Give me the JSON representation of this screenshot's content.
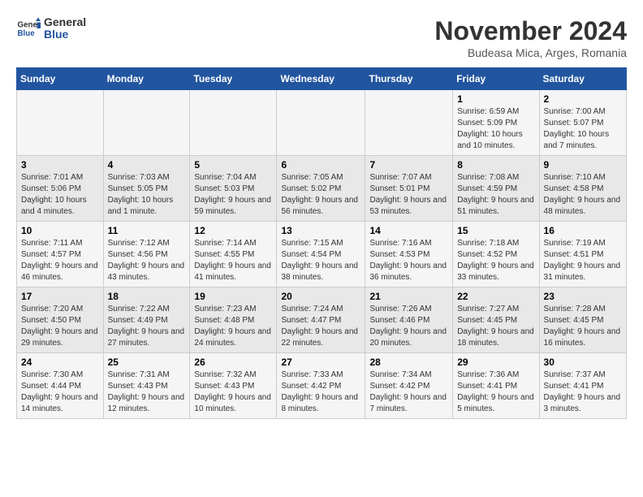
{
  "logo": {
    "line1": "General",
    "line2": "Blue"
  },
  "title": "November 2024",
  "subtitle": "Budeasa Mica, Arges, Romania",
  "weekdays": [
    "Sunday",
    "Monday",
    "Tuesday",
    "Wednesday",
    "Thursday",
    "Friday",
    "Saturday"
  ],
  "weeks": [
    [
      {
        "day": "",
        "info": ""
      },
      {
        "day": "",
        "info": ""
      },
      {
        "day": "",
        "info": ""
      },
      {
        "day": "",
        "info": ""
      },
      {
        "day": "",
        "info": ""
      },
      {
        "day": "1",
        "info": "Sunrise: 6:59 AM\nSunset: 5:09 PM\nDaylight: 10 hours and 10 minutes."
      },
      {
        "day": "2",
        "info": "Sunrise: 7:00 AM\nSunset: 5:07 PM\nDaylight: 10 hours and 7 minutes."
      }
    ],
    [
      {
        "day": "3",
        "info": "Sunrise: 7:01 AM\nSunset: 5:06 PM\nDaylight: 10 hours and 4 minutes."
      },
      {
        "day": "4",
        "info": "Sunrise: 7:03 AM\nSunset: 5:05 PM\nDaylight: 10 hours and 1 minute."
      },
      {
        "day": "5",
        "info": "Sunrise: 7:04 AM\nSunset: 5:03 PM\nDaylight: 9 hours and 59 minutes."
      },
      {
        "day": "6",
        "info": "Sunrise: 7:05 AM\nSunset: 5:02 PM\nDaylight: 9 hours and 56 minutes."
      },
      {
        "day": "7",
        "info": "Sunrise: 7:07 AM\nSunset: 5:01 PM\nDaylight: 9 hours and 53 minutes."
      },
      {
        "day": "8",
        "info": "Sunrise: 7:08 AM\nSunset: 4:59 PM\nDaylight: 9 hours and 51 minutes."
      },
      {
        "day": "9",
        "info": "Sunrise: 7:10 AM\nSunset: 4:58 PM\nDaylight: 9 hours and 48 minutes."
      }
    ],
    [
      {
        "day": "10",
        "info": "Sunrise: 7:11 AM\nSunset: 4:57 PM\nDaylight: 9 hours and 46 minutes."
      },
      {
        "day": "11",
        "info": "Sunrise: 7:12 AM\nSunset: 4:56 PM\nDaylight: 9 hours and 43 minutes."
      },
      {
        "day": "12",
        "info": "Sunrise: 7:14 AM\nSunset: 4:55 PM\nDaylight: 9 hours and 41 minutes."
      },
      {
        "day": "13",
        "info": "Sunrise: 7:15 AM\nSunset: 4:54 PM\nDaylight: 9 hours and 38 minutes."
      },
      {
        "day": "14",
        "info": "Sunrise: 7:16 AM\nSunset: 4:53 PM\nDaylight: 9 hours and 36 minutes."
      },
      {
        "day": "15",
        "info": "Sunrise: 7:18 AM\nSunset: 4:52 PM\nDaylight: 9 hours and 33 minutes."
      },
      {
        "day": "16",
        "info": "Sunrise: 7:19 AM\nSunset: 4:51 PM\nDaylight: 9 hours and 31 minutes."
      }
    ],
    [
      {
        "day": "17",
        "info": "Sunrise: 7:20 AM\nSunset: 4:50 PM\nDaylight: 9 hours and 29 minutes."
      },
      {
        "day": "18",
        "info": "Sunrise: 7:22 AM\nSunset: 4:49 PM\nDaylight: 9 hours and 27 minutes."
      },
      {
        "day": "19",
        "info": "Sunrise: 7:23 AM\nSunset: 4:48 PM\nDaylight: 9 hours and 24 minutes."
      },
      {
        "day": "20",
        "info": "Sunrise: 7:24 AM\nSunset: 4:47 PM\nDaylight: 9 hours and 22 minutes."
      },
      {
        "day": "21",
        "info": "Sunrise: 7:26 AM\nSunset: 4:46 PM\nDaylight: 9 hours and 20 minutes."
      },
      {
        "day": "22",
        "info": "Sunrise: 7:27 AM\nSunset: 4:45 PM\nDaylight: 9 hours and 18 minutes."
      },
      {
        "day": "23",
        "info": "Sunrise: 7:28 AM\nSunset: 4:45 PM\nDaylight: 9 hours and 16 minutes."
      }
    ],
    [
      {
        "day": "24",
        "info": "Sunrise: 7:30 AM\nSunset: 4:44 PM\nDaylight: 9 hours and 14 minutes."
      },
      {
        "day": "25",
        "info": "Sunrise: 7:31 AM\nSunset: 4:43 PM\nDaylight: 9 hours and 12 minutes."
      },
      {
        "day": "26",
        "info": "Sunrise: 7:32 AM\nSunset: 4:43 PM\nDaylight: 9 hours and 10 minutes."
      },
      {
        "day": "27",
        "info": "Sunrise: 7:33 AM\nSunset: 4:42 PM\nDaylight: 9 hours and 8 minutes."
      },
      {
        "day": "28",
        "info": "Sunrise: 7:34 AM\nSunset: 4:42 PM\nDaylight: 9 hours and 7 minutes."
      },
      {
        "day": "29",
        "info": "Sunrise: 7:36 AM\nSunset: 4:41 PM\nDaylight: 9 hours and 5 minutes."
      },
      {
        "day": "30",
        "info": "Sunrise: 7:37 AM\nSunset: 4:41 PM\nDaylight: 9 hours and 3 minutes."
      }
    ]
  ]
}
